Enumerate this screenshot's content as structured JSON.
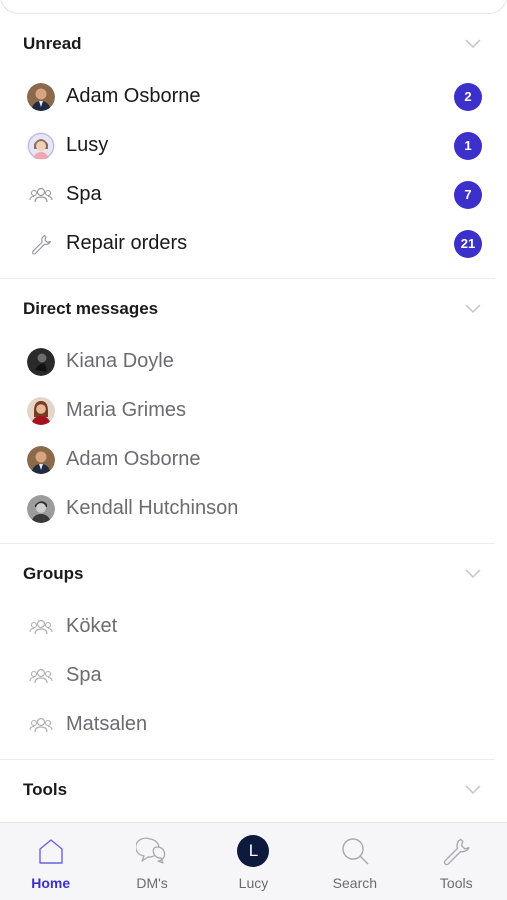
{
  "sections": {
    "unread": {
      "title": "Unread",
      "items": [
        {
          "label": "Adam Osborne",
          "badge": "2",
          "icon": "avatar-adam"
        },
        {
          "label": "Lusy",
          "badge": "1",
          "icon": "avatar-lusy"
        },
        {
          "label": "Spa",
          "badge": "7",
          "icon": "group-icon"
        },
        {
          "label": "Repair orders",
          "badge": "21",
          "icon": "wrench-icon"
        }
      ]
    },
    "direct_messages": {
      "title": "Direct messages",
      "items": [
        {
          "label": "Kiana Doyle",
          "icon": "avatar-kiana"
        },
        {
          "label": "Maria Grimes",
          "icon": "avatar-maria"
        },
        {
          "label": "Adam Osborne",
          "icon": "avatar-adam"
        },
        {
          "label": "Kendall Hutchinson",
          "icon": "avatar-kendall"
        }
      ]
    },
    "groups": {
      "title": "Groups",
      "items": [
        {
          "label": "Köket",
          "icon": "group-icon"
        },
        {
          "label": "Spa",
          "icon": "group-icon"
        },
        {
          "label": "Matsalen",
          "icon": "group-icon"
        }
      ]
    },
    "tools": {
      "title": "Tools"
    }
  },
  "tabbar": {
    "tabs": [
      {
        "label": "Home",
        "icon": "home-icon",
        "active": true
      },
      {
        "label": "DM's",
        "icon": "chat-bubbles-icon"
      },
      {
        "label": "Lucy",
        "icon": "profile-avatar",
        "initial": "L"
      },
      {
        "label": "Search",
        "icon": "search-icon"
      },
      {
        "label": "Tools",
        "icon": "wrench-icon"
      }
    ]
  },
  "colors": {
    "accent": "#3b30c9",
    "badge_bg": "#3b30c9",
    "profile_bg": "#0e1a3d",
    "muted_text": "#6b6b72"
  }
}
